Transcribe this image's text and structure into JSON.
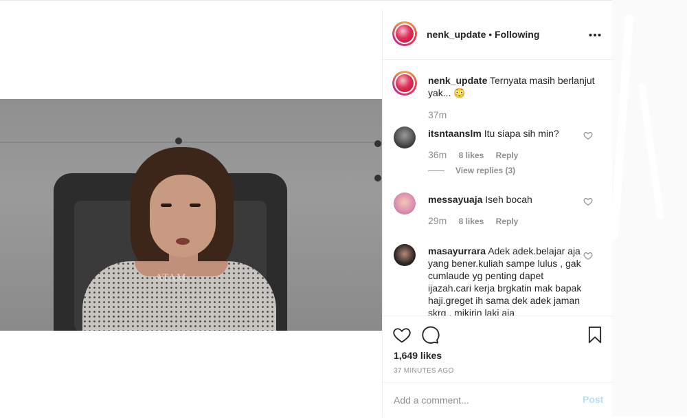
{
  "post": {
    "username": "nenk_update",
    "separator": "•",
    "follow_status": "Following",
    "more_label": "•••"
  },
  "caption": {
    "username": "nenk_update",
    "text": "Ternyata masih berlanjut yak... 😳",
    "time": "37m"
  },
  "comments": [
    {
      "username": "itsntaanslm",
      "text": "Itu siapa sih min?",
      "time": "36m",
      "likes": "8 likes",
      "reply_label": "Reply",
      "view_replies": "View replies (3)"
    },
    {
      "username": "messayuaja",
      "text": "Iseh bocah",
      "time": "29m",
      "likes": "8 likes",
      "reply_label": "Reply"
    },
    {
      "username": "masayurrara",
      "text": "Adek adek.belajar aja yang bener.kuliah sampe lulus , gak cumlaude yg penting dapet ijazah.cari kerja brgkatin mak bapak haji.greget ih sama dek adek jaman skrg . mikirin laki aja"
    }
  ],
  "media": {
    "watermark": "ATAM"
  },
  "actions": {
    "like_icon": "heart-icon",
    "comment_icon": "comment-icon",
    "save_icon": "bookmark-icon"
  },
  "likes_count": "1,649 likes",
  "posted_ago": "37 MINUTES AGO",
  "add_comment": {
    "placeholder": "Add a comment...",
    "post_label": "Post"
  },
  "colors": {
    "text": "#262626",
    "muted": "#8e8e8e",
    "post_disabled": "#b2dffc",
    "border": "#efefef"
  }
}
